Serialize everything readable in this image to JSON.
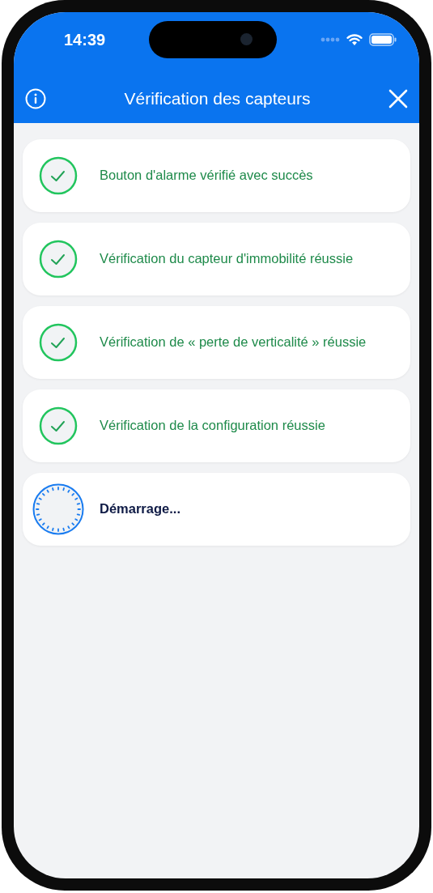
{
  "status_bar": {
    "time": "14:39"
  },
  "header": {
    "title": "Vérification des capteurs"
  },
  "checks": [
    {
      "kind": "success",
      "label": "Bouton d'alarme vérifié avec succès"
    },
    {
      "kind": "success",
      "label": "Vérification du capteur d'immobilité réussie"
    },
    {
      "kind": "success",
      "label": "Vérification de « perte de verticalité » réussie"
    },
    {
      "kind": "success",
      "label": "Vérification de la configuration réussie"
    },
    {
      "kind": "loading",
      "label": "Démarrage..."
    }
  ]
}
